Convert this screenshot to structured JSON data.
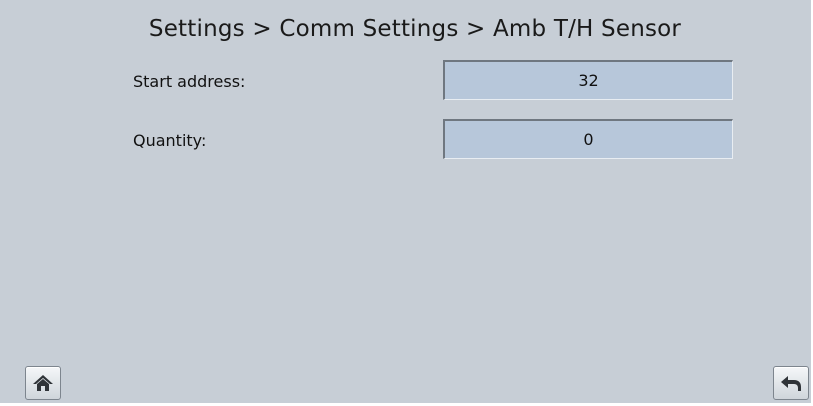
{
  "header": {
    "breadcrumb": "Settings > Comm Settings > Amb T/H Sensor"
  },
  "fields": [
    {
      "label": "Start address:",
      "value": "32"
    },
    {
      "label": "Quantity:",
      "value": "0"
    }
  ],
  "footer": {
    "home_icon": "home-icon",
    "back_icon": "back-arrow-icon"
  },
  "colors": {
    "background": "#c7ced6",
    "field_fill": "#b7c7da"
  }
}
